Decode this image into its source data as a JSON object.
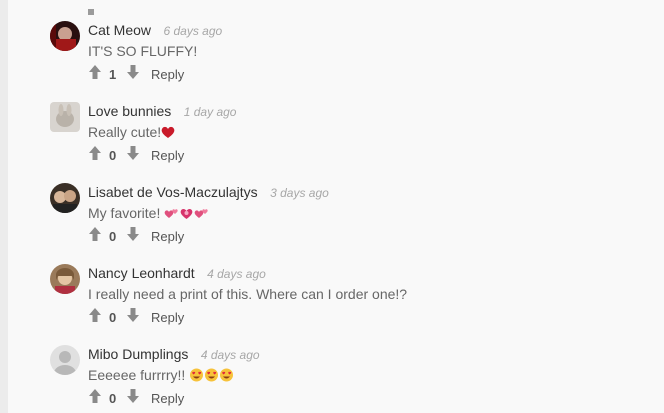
{
  "comments": [
    {
      "author": "Cat Meow",
      "time": "6 days ago",
      "text": "IT'S SO FLUFFY!",
      "votes": "1",
      "reply_label": "Reply",
      "emojis": []
    },
    {
      "author": "Love bunnies",
      "time": "1 day ago",
      "text": "Really cute!",
      "votes": "0",
      "reply_label": "Reply",
      "emojis": [
        "red-heart"
      ]
    },
    {
      "author": "Lisabet de Vos-Maczulajtys",
      "time": "3 days ago",
      "text": "My favorite! ",
      "votes": "0",
      "reply_label": "Reply",
      "emojis": [
        "two-hearts",
        "heart-with-ribbon",
        "two-hearts"
      ]
    },
    {
      "author": "Nancy Leonhardt",
      "time": "4 days ago",
      "text": "I really need a print of this. Where can I order one!?",
      "votes": "0",
      "reply_label": "Reply",
      "emojis": []
    },
    {
      "author": "Mibo Dumplings",
      "time": "4 days ago",
      "text": "Eeeeee furrrry!! ",
      "votes": "0",
      "reply_label": "Reply",
      "emojis": [
        "heart-eyes-smiley",
        "heart-eyes-smiley",
        "heart-eyes-smiley"
      ]
    }
  ],
  "colors": {
    "background": "#f9f9f9",
    "author": "#333333",
    "timestamp": "#a7a7a7",
    "text": "#666666",
    "icon": "#8a8a8a"
  },
  "icons": [
    "arrow-up-icon",
    "arrow-down-icon",
    "avatar"
  ]
}
